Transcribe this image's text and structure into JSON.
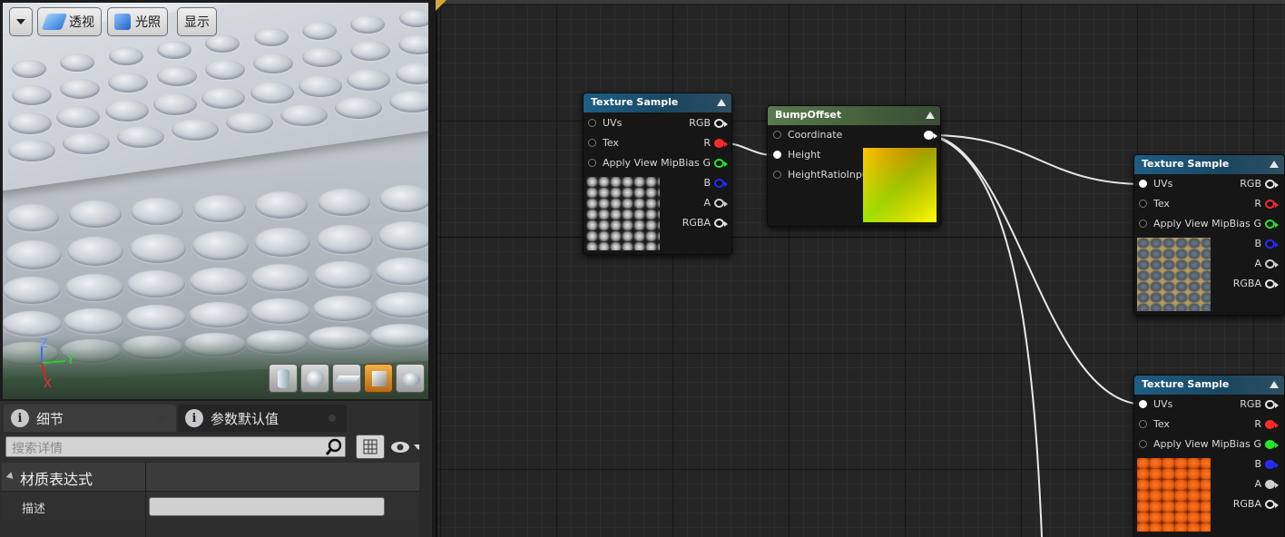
{
  "viewport": {
    "toolbar": {
      "dropdown_label": "",
      "perspective_label": "透视",
      "lit_label": "光照",
      "show_label": "显示"
    },
    "axis": {
      "z": "Z",
      "y": "Y",
      "x": "X"
    },
    "preview_shapes": [
      "cylinder",
      "sphere",
      "plane",
      "cube",
      "teapot"
    ],
    "active_shape": "cube"
  },
  "details": {
    "tabs": [
      {
        "label": "细节"
      },
      {
        "label": "参数默认值"
      }
    ],
    "search_placeholder": "搜索详情",
    "category": "材质表达式",
    "property_label": "描述",
    "property_value": ""
  },
  "graph": {
    "nodes": {
      "tex1": {
        "title": "Texture Sample",
        "inputs": [
          "UVs",
          "Tex",
          "Apply View MipBias"
        ],
        "outputs": [
          "RGB",
          "R",
          "G",
          "B",
          "A",
          "RGBA"
        ]
      },
      "bump": {
        "title": "BumpOffset",
        "inputs": [
          "Coordinate",
          "Height",
          "HeightRatioInput"
        ]
      },
      "tex2": {
        "title": "Texture Sample",
        "inputs": [
          "UVs",
          "Tex",
          "Apply View MipBias"
        ],
        "outputs": [
          "RGB",
          "R",
          "G",
          "B",
          "A",
          "RGBA"
        ]
      },
      "tex3": {
        "title": "Texture Sample",
        "inputs": [
          "UVs",
          "Tex",
          "Apply View MipBias"
        ],
        "outputs": [
          "RGB",
          "R",
          "G",
          "B",
          "A",
          "RGBA"
        ]
      }
    },
    "colors": {
      "texture_header": "#1d5e86",
      "bump_header": "#5a7a4e",
      "pin_r": "#ff2a2a",
      "pin_g": "#26e626",
      "pin_b": "#2a2aff"
    }
  }
}
